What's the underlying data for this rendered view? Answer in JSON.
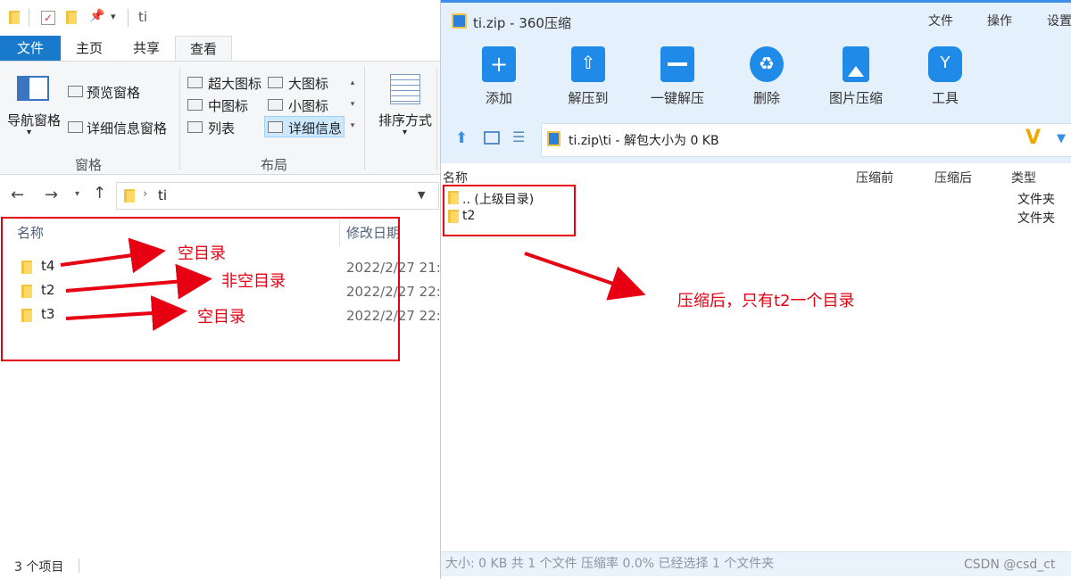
{
  "explorer": {
    "path_title": "ti",
    "tabs": [
      "文件",
      "主页",
      "共享",
      "查看"
    ],
    "ribbon": {
      "nav_pane": "导航窗格",
      "preview_pane": "预览窗格",
      "details_pane": "详细信息窗格",
      "pane_group": "窗格",
      "xl_icons": "超大图标",
      "large_icons": "大图标",
      "medium_icons": "中图标",
      "small_icons": "小图标",
      "list": "列表",
      "details": "详细信息",
      "layout_group": "布局",
      "sort_by": "排序方式"
    },
    "address": "ti",
    "columns": {
      "name": "名称",
      "modified": "修改日期"
    },
    "rows": [
      {
        "name": "t4",
        "date": "2022/2/27 21:"
      },
      {
        "name": "t2",
        "date": "2022/2/27 22:"
      },
      {
        "name": "t3",
        "date": "2022/2/27 22:"
      }
    ],
    "status": "3 个项目"
  },
  "zip": {
    "title": "ti.zip - 360压缩",
    "menu": [
      "文件",
      "操作",
      "设置"
    ],
    "toolbar": [
      "添加",
      "解压到",
      "一键解压",
      "删除",
      "图片压缩",
      "工具"
    ],
    "path": "ti.zip\\ti - 解包大小为 0 KB",
    "columns": {
      "name": "名称",
      "packed": "压缩前",
      "compressed": "压缩后",
      "type": "类型"
    },
    "rows": [
      {
        "name": ".. (上级目录)",
        "type": "文件夹"
      },
      {
        "name": "t2",
        "type": "文件夹"
      }
    ],
    "status": "大小: 0 KB 共 1 个文件 压缩率 0.0% 已经选择 1 个文件夹"
  },
  "annotations": {
    "t4": "空目录",
    "t2": "非空目录",
    "t3": "空目录",
    "right": "压缩后，只有t2一个目录"
  },
  "watermark": "CSDN @csd_ct"
}
